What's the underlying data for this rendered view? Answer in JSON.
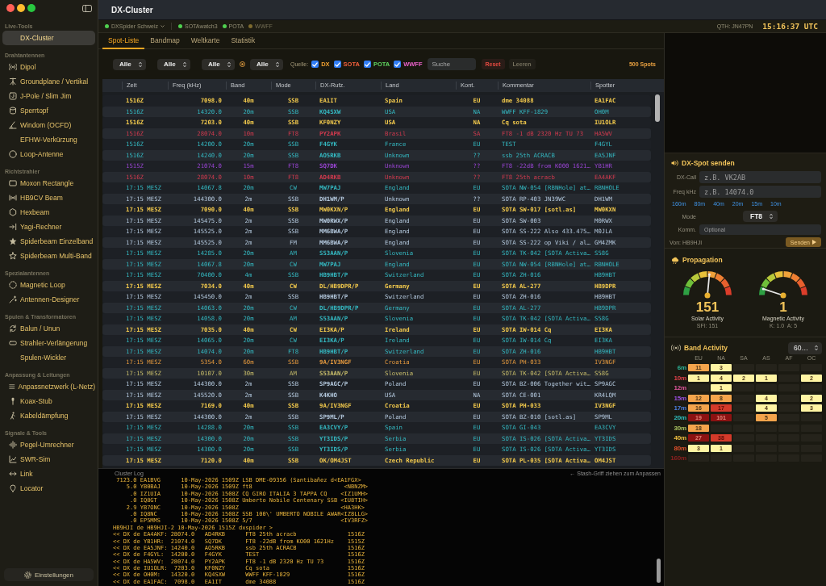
{
  "window": {
    "title": "DX-Cluster"
  },
  "sidebar": {
    "sections": [
      {
        "title": "Live-Tools",
        "items": [
          {
            "label": "DX-Cluster",
            "selected": true
          }
        ]
      },
      {
        "title": "Drahtantennen",
        "items": [
          {
            "label": "Dipol",
            "selected": false
          },
          {
            "label": "Groundplane / Vertikal",
            "selected": false
          },
          {
            "label": "J-Pole / Slim Jim",
            "selected": false
          },
          {
            "label": "Sperrtopf",
            "selected": false
          },
          {
            "label": "Windom (OCFD)",
            "selected": false
          },
          {
            "label": "EFHW-Verkürzung",
            "selected": false
          },
          {
            "label": "Loop-Antenne",
            "selected": false
          }
        ]
      },
      {
        "title": "Richtstrahler",
        "items": [
          {
            "label": "Moxon Rectangle",
            "selected": false
          },
          {
            "label": "HB9CV Beam",
            "selected": false
          },
          {
            "label": "Hexbeam",
            "selected": false
          },
          {
            "label": "Yagi-Rechner",
            "selected": false
          },
          {
            "label": "Spiderbeam Einzelband",
            "selected": false
          },
          {
            "label": "Spiderbeam Multi-Band",
            "selected": false
          }
        ]
      },
      {
        "title": "Spezialantennen",
        "items": [
          {
            "label": "Magnetic Loop",
            "selected": false
          },
          {
            "label": "Antennen-Designer",
            "selected": false
          }
        ]
      },
      {
        "title": "Spulen & Transformatoren",
        "items": [
          {
            "label": "Balun / Unun",
            "selected": false
          },
          {
            "label": "Strahler-Verlängerung",
            "selected": false
          },
          {
            "label": "Spulen-Wickler",
            "selected": false
          }
        ]
      },
      {
        "title": "Anpassung & Leitungen",
        "items": [
          {
            "label": "Anpassnetzwerk (L-Netz)",
            "selected": false
          },
          {
            "label": "Koax-Stub",
            "selected": false
          },
          {
            "label": "Kabeldämpfung",
            "selected": false
          }
        ]
      },
      {
        "title": "Signale & Tools",
        "items": [
          {
            "label": "Pegel-Umrechner",
            "selected": false
          },
          {
            "label": "SWR-Sim",
            "selected": false
          },
          {
            "label": "Link",
            "selected": false
          },
          {
            "label": "Locator",
            "selected": false
          }
        ]
      }
    ],
    "footer": {
      "label": "Einstellungen"
    }
  },
  "status_bar": {
    "sources": [
      {
        "label": "DXSpider Schweiz",
        "connected": true,
        "dropdown": true
      },
      {
        "label": "SOTAwatch3",
        "connected": true,
        "dropdown": false
      },
      {
        "label": "POTA",
        "connected": true,
        "dropdown": false
      },
      {
        "label": "WWFF",
        "connected": false,
        "dropdown": false
      }
    ],
    "qth": "QTH: JN47PN",
    "clock": "15:16:37 UTC"
  },
  "tabs": [
    {
      "label": "Spot-Liste",
      "selected": true
    },
    {
      "label": "Bandmap",
      "selected": false
    },
    {
      "label": "Weltkarte",
      "selected": false
    },
    {
      "label": "Statistik",
      "selected": false
    }
  ],
  "filters": {
    "selects": [
      {
        "value": "Alle"
      },
      {
        "value": "Alle"
      },
      {
        "value": "Alle"
      },
      {
        "value": "Alle"
      }
    ],
    "source_label": "Quelle:",
    "sources": [
      {
        "label": "DX",
        "checked": true,
        "color": "#f0a030"
      },
      {
        "label": "SOTA",
        "checked": true,
        "color": "#f2603c"
      },
      {
        "label": "POTA",
        "checked": true,
        "color": "#5fd35f"
      },
      {
        "label": "WWFF",
        "checked": true,
        "color": "#e861c8"
      }
    ],
    "search": {
      "placeholder": "Suche"
    },
    "buttons": [
      {
        "label": "Reset",
        "disabled": false
      },
      {
        "label": "Leeren",
        "disabled": true
      }
    ],
    "count": "500 Spots"
  },
  "table": {
    "columns": [
      "Zeit",
      "Freq (kHz)",
      "Band",
      "Mode",
      "DX-Rufz.",
      "Land",
      "Kont.",
      "Kommentar",
      "Spotter"
    ],
    "rows": [
      {
        "color": "#f2c94c",
        "emphasized": true,
        "cells": [
          "1516Z",
          "7098.0",
          "40m",
          "SSB",
          "EA1IT",
          "Spain",
          "EU",
          "dme 34088",
          "EA1FAC"
        ]
      },
      {
        "color": "#34b9c2",
        "emphasized": false,
        "cells": [
          "1516Z",
          "14320.0",
          "20m",
          "SSB",
          "KQ4SXW",
          "USA",
          "NA",
          "WWFF KFF-1829",
          "OH0M"
        ]
      },
      {
        "color": "#f2c94c",
        "emphasized": true,
        "cells": [
          "1516Z",
          "7203.0",
          "40m",
          "SSB",
          "KF0NZY",
          "USA",
          "NA",
          "Cq sota",
          "IU1OLR"
        ]
      },
      {
        "color": "#d23a4e",
        "emphasized": false,
        "cells": [
          "1516Z",
          "28074.0",
          "10m",
          "FT8",
          "PY2APK",
          "Brasil",
          "SA",
          "FT8 -1 dB 2320 Hz TU 73",
          "HA5WV"
        ]
      },
      {
        "color": "#34b9c2",
        "emphasized": false,
        "cells": [
          "1516Z",
          "14200.0",
          "20m",
          "SSB",
          "F4GYK",
          "France",
          "EU",
          "TEST",
          "F4GYL"
        ]
      },
      {
        "color": "#34b9c2",
        "emphasized": false,
        "cells": [
          "1516Z",
          "14240.0",
          "20m",
          "SSB",
          "AO5RKB",
          "Unknown",
          "??",
          "ssb 25th ACRACB",
          "EA5JNF"
        ]
      },
      {
        "color": "#9a44d4",
        "emphasized": false,
        "cells": [
          "1515Z",
          "21074.0",
          "15m",
          "FT8",
          "SQ7DK",
          "Unknown",
          "??",
          "FT8 -22dB from KO00 1621…",
          "YB1HR"
        ]
      },
      {
        "color": "#d23a4e",
        "emphasized": false,
        "cells": [
          "1516Z",
          "28074.0",
          "10m",
          "FT8",
          "AD4RKB",
          "Unknown",
          "??",
          "FT8 25th acracb",
          "EA4AKF"
        ]
      },
      {
        "color": "#34b9c2",
        "emphasized": false,
        "cells": [
          "17:15 MESZ",
          "14067.8",
          "20m",
          "CW",
          "MW7PAJ",
          "England",
          "EU",
          "SOTA NW-054 [RBNHole] at…",
          "RBNHOLE"
        ]
      },
      {
        "color": "#b4c9de",
        "emphasized": false,
        "cells": [
          "17:15 MESZ",
          "144300.0",
          "2m",
          "SSB",
          "DH1WM/P",
          "Unknown",
          "??",
          "SOTA RP-403 JN39WC",
          "DH1WM"
        ]
      },
      {
        "color": "#f2c94c",
        "emphasized": true,
        "cells": [
          "17:15 MESZ",
          "7090.0",
          "40m",
          "SSB",
          "MW0KXN/P",
          "England",
          "EU",
          "SOTA SW-017 [sotl.as]",
          "MW0KXN"
        ]
      },
      {
        "color": "#b4c9de",
        "emphasized": false,
        "cells": [
          "17:15 MESZ",
          "145475.0",
          "2m",
          "SSB",
          "MW0RWX/P",
          "England",
          "EU",
          "SOTA SW-003",
          "M0RWX"
        ]
      },
      {
        "color": "#b4c9de",
        "emphasized": false,
        "cells": [
          "17:15 MESZ",
          "145525.0",
          "2m",
          "SSB",
          "MM6BWA/P",
          "England",
          "EU",
          "SOTA SS-222 Also 433.475…",
          "M0JLA"
        ]
      },
      {
        "color": "#b4c9de",
        "emphasized": false,
        "cells": [
          "17:15 MESZ",
          "145525.0",
          "2m",
          "FM",
          "MM6BWA/P",
          "England",
          "EU",
          "SOTA SS-222 op Viki / al…",
          "GM4ZMK"
        ]
      },
      {
        "color": "#34b9c2",
        "emphasized": false,
        "cells": [
          "17:15 MESZ",
          "14285.0",
          "20m",
          "AM",
          "S53AAN/P",
          "Slovenia",
          "EU",
          "SOTA TK-042 [SOTA Activa…",
          "S58G"
        ]
      },
      {
        "color": "#34b9c2",
        "emphasized": false,
        "cells": [
          "17:15 MESZ",
          "14067.8",
          "20m",
          "CW",
          "MW7PAJ",
          "England",
          "EU",
          "SOTA NW-054 [RBNHole] at…",
          "RBNHOLE"
        ]
      },
      {
        "color": "#34b9c2",
        "emphasized": false,
        "cells": [
          "17:15 MESZ",
          "70400.0",
          "4m",
          "SSB",
          "HB9HBT/P",
          "Switzerland",
          "EU",
          "SOTA ZH-016",
          "HB9HBT"
        ]
      },
      {
        "color": "#f2c94c",
        "emphasized": true,
        "cells": [
          "17:15 MESZ",
          "7034.0",
          "40m",
          "CW",
          "DL/HB9DPR/P",
          "Germany",
          "EU",
          "SOTA AL-277",
          "HB9DPR"
        ]
      },
      {
        "color": "#b4c9de",
        "emphasized": false,
        "cells": [
          "17:15 MESZ",
          "145450.0",
          "2m",
          "SSB",
          "HB9HBT/P",
          "Switzerland",
          "EU",
          "SOTA ZH-016",
          "HB9HBT"
        ]
      },
      {
        "color": "#34b9c2",
        "emphasized": false,
        "cells": [
          "17:15 MESZ",
          "14063.0",
          "20m",
          "CW",
          "DL/HB9DPR/P",
          "Germany",
          "EU",
          "SOTA AL-277",
          "HB9DPR"
        ]
      },
      {
        "color": "#34b9c2",
        "emphasized": false,
        "cells": [
          "17:15 MESZ",
          "14058.0",
          "20m",
          "AM",
          "S53AAN/P",
          "Slovenia",
          "EU",
          "SOTA TK-042 [SOTA Activa…",
          "S58G"
        ]
      },
      {
        "color": "#f2c94c",
        "emphasized": true,
        "cells": [
          "17:15 MESZ",
          "7035.0",
          "40m",
          "CW",
          "EI3KA/P",
          "Ireland",
          "EU",
          "SOTA IW-014 Cq",
          "EI3KA"
        ]
      },
      {
        "color": "#34b9c2",
        "emphasized": false,
        "cells": [
          "17:15 MESZ",
          "14065.0",
          "20m",
          "CW",
          "EI3KA/P",
          "Ireland",
          "EU",
          "SOTA IW-014 Cq",
          "EI3KA"
        ]
      },
      {
        "color": "#34b9c2",
        "emphasized": false,
        "cells": [
          "17:15 MESZ",
          "14074.0",
          "20m",
          "FT8",
          "HB9HBT/P",
          "Switzerland",
          "EU",
          "SOTA ZH-016",
          "HB9HBT"
        ]
      },
      {
        "color": "#e69a3e",
        "emphasized": false,
        "cells": [
          "17:15 MESZ",
          "5354.0",
          "60m",
          "SSB",
          "9A/IV3NGF",
          "Croatia",
          "EU",
          "SOTA PH-033",
          "IV3NGF"
        ]
      },
      {
        "color": "#c9be6a",
        "emphasized": false,
        "cells": [
          "17:15 MESZ",
          "10107.0",
          "30m",
          "AM",
          "S53AAN/P",
          "Slovenia",
          "EU",
          "SOTA TK-042 [SOTA Activa…",
          "S58G"
        ]
      },
      {
        "color": "#b4c9de",
        "emphasized": false,
        "cells": [
          "17:15 MESZ",
          "144300.0",
          "2m",
          "SSB",
          "SP9AGC/P",
          "Poland",
          "EU",
          "SOTA BZ-006 Together wit…",
          "SP9AGC"
        ]
      },
      {
        "color": "#b4c9de",
        "emphasized": false,
        "cells": [
          "17:15 MESZ",
          "145520.0",
          "2m",
          "SSB",
          "K4KHO",
          "USA",
          "NA",
          "SOTA CE-001",
          "KR4LQM"
        ]
      },
      {
        "color": "#f2c94c",
        "emphasized": true,
        "cells": [
          "17:15 MESZ",
          "7169.0",
          "40m",
          "SSB",
          "9A/IV3NGF",
          "Croatia",
          "EU",
          "SOTA PH-033",
          "IV3NGF"
        ]
      },
      {
        "color": "#b4c9de",
        "emphasized": false,
        "cells": [
          "17:15 MESZ",
          "144300.0",
          "2m",
          "SSB",
          "SP9ML/P",
          "Poland",
          "EU",
          "SOTA BZ-010 [sotl.as]",
          "SP9ML"
        ]
      },
      {
        "color": "#34b9c2",
        "emphasized": false,
        "cells": [
          "17:15 MESZ",
          "14288.0",
          "20m",
          "SSB",
          "EA3CVY/P",
          "Spain",
          "EU",
          "SOTA GI-043",
          "EA3CVY"
        ]
      },
      {
        "color": "#34b9c2",
        "emphasized": false,
        "cells": [
          "17:15 MESZ",
          "14300.0",
          "20m",
          "SSB",
          "YT3IDS/P",
          "Serbia",
          "EU",
          "SOTA IS-026 [SOTA Activa…",
          "YT3IDS"
        ]
      },
      {
        "color": "#34b9c2",
        "emphasized": false,
        "cells": [
          "17:15 MESZ",
          "14300.0",
          "20m",
          "SSB",
          "YT3IDS/P",
          "Serbia",
          "EU",
          "SOTA IS-026 [SOTA Activa…",
          "YT3IDS"
        ]
      },
      {
        "color": "#f2c94c",
        "emphasized": true,
        "cells": [
          "17:15 MESZ",
          "7120.0",
          "40m",
          "SSB",
          "OK/OM4JST",
          "Czech Republic",
          "EU",
          "SOTA PL-035 [SOTA Activa…",
          "OM4JST"
        ]
      }
    ]
  },
  "cluster_log": {
    "title": "Cluster Log",
    "hint": "← Stash-Griff ziehen zum Anpassen",
    "lines": [
      " 7123.0 EA1BVG      10-May-2026 1509Z LSB DME-09356 (Santibañez d<EA1FGX>",
      "    5.0 YB0BAJ      10-May-2026 1509Z ft8                           <NBNZM>",
      "     .0 IZ1UIA      10-May-2026 1508Z CQ GIRO ITALIA 3 TAPPA CQ    <IZ1UMH>",
      "     .0 IQ8GT       10-May-2026 1508Z Umberto Nobile Centenary SSB <IU8TIH>",
      "    2.9 YB7ONC      10-May-2026 1508Z                              <HA3HK>",
      "     .0 IQ8NC       10-May-2026 1508Z SSB 100\\' UMBERTO NOBILE AWAR<IZ8LLG>",
      "     .0 EP5MMS      10-May-2026 1508Z 5/7                          <IV3RFZ>",
      "HB9HJI de HB9HJI-2 10-May-2026 1515Z dxspider >",
      "<< DX de EA4AKF: 28074.0   AD4RKB      FT8 25th acracb               1516Z",
      "<< DX de YB1HR:  21074.0   SQ7DK       FT8 -22dB from KO00 1621Hz    1515Z",
      "<< DX de EA5JNF: 14240.0   AO5RKB      ssb 25th ACRACB               1516Z",
      "<< DX de F4GYL:  14200.0   F4GYK       TEST                          1516Z",
      "<< DX de HA5WV:  28074.0   PY2APK      FT8 -1 dB 2320 Hz TU 73       1516Z",
      "<< DX de IU1OLR:  7203.0   KF0NZY      Cq sota                       1516Z",
      "<< DX de OH0M:   14320.0   KQ4SXW      WWFF KFF-1829                 1516Z",
      "<< DX de EA1FAC:  7098.0   EA1IT       dme 34088                     1516Z"
    ]
  },
  "spot_form": {
    "title": "DX-Spot senden",
    "fields": [
      {
        "label": "DX-Call",
        "placeholder": "z.B. VK2AB"
      },
      {
        "label": "Freq kHz",
        "placeholder": "z.B. 14074.0"
      }
    ],
    "bands": [
      "160m",
      "80m",
      "40m",
      "20m",
      "15m",
      "10m"
    ],
    "mode": {
      "label": "Mode",
      "value": "FT8"
    },
    "comment": {
      "label": "Komm.",
      "placeholder": "Optional"
    },
    "sender": "Von: HB9HJI",
    "submit": "Senden"
  },
  "propagation": {
    "title": "Propagation",
    "gauges": [
      {
        "value": "151",
        "label": "Solar Activity",
        "detail": "SFI: 151",
        "level": 0.53
      },
      {
        "value": "1",
        "label": "Magnetic Activity",
        "detail": "K: 1.0  A: 5",
        "level": 0.1
      }
    ]
  },
  "band_activity": {
    "title": "Band Activity",
    "range": "60…",
    "columns": [
      "EU",
      "NA",
      "SA",
      "AS",
      "AF",
      "OC"
    ],
    "rows": [
      {
        "band": "6m",
        "color": "#2eb89a",
        "cells": [
          {
            "value": "11",
            "color": "#f4a44c"
          },
          {
            "value": "3",
            "color": "#fff4a3"
          },
          null,
          null,
          null,
          null
        ]
      },
      {
        "band": "10m",
        "color": "#e0404a",
        "cells": [
          {
            "value": "1",
            "color": "#fff4a3"
          },
          {
            "value": "4",
            "color": "#fff4a3"
          },
          {
            "value": "2",
            "color": "#fff4a3"
          },
          {
            "value": "1",
            "color": "#fff4a3"
          },
          null,
          {
            "value": "2",
            "color": "#fff4a3"
          }
        ]
      },
      {
        "band": "12m",
        "color": "#e2589e",
        "cells": [
          null,
          {
            "value": "1",
            "color": "#fff4a3"
          },
          null,
          null,
          null,
          null
        ]
      },
      {
        "band": "15m",
        "color": "#9a4ee0",
        "cells": [
          {
            "value": "12",
            "color": "#f4a44c"
          },
          {
            "value": "8",
            "color": "#f4a44c"
          },
          null,
          {
            "value": "4",
            "color": "#fff4a3"
          },
          null,
          {
            "value": "2",
            "color": "#fff4a3"
          }
        ]
      },
      {
        "band": "17m",
        "color": "#4c7fe0",
        "cells": [
          {
            "value": "16",
            "color": "#f4a44c"
          },
          {
            "value": "17",
            "color": "#d43a2a"
          },
          null,
          {
            "value": "4",
            "color": "#fff4a3"
          },
          null,
          {
            "value": "3",
            "color": "#fff4a3"
          }
        ]
      },
      {
        "band": "20m",
        "color": "#2fc0c0",
        "cells": [
          {
            "value": "19",
            "color": "#8c1212"
          },
          {
            "value": "101",
            "color": "#8c1212"
          },
          null,
          {
            "value": "5",
            "color": "#f4a44c"
          },
          null,
          null
        ]
      },
      {
        "band": "30m",
        "color": "#a8c060",
        "cells": [
          {
            "value": "18",
            "color": "#f4a44c"
          },
          null,
          null,
          null,
          null,
          null
        ]
      },
      {
        "band": "40m",
        "color": "#f0c040",
        "cells": [
          {
            "value": "27",
            "color": "#8c1212"
          },
          {
            "value": "38",
            "color": "#d43a2a"
          },
          null,
          null,
          null,
          null
        ]
      },
      {
        "band": "80m",
        "color": "#e0502a",
        "cells": [
          {
            "value": "3",
            "color": "#fff4a3"
          },
          {
            "value": "1",
            "color": "#fff4a3"
          },
          null,
          null,
          null,
          null
        ]
      },
      {
        "band": "160m",
        "color": "#8a2020",
        "cells": [
          null,
          null,
          null,
          null,
          null,
          null
        ]
      }
    ]
  }
}
